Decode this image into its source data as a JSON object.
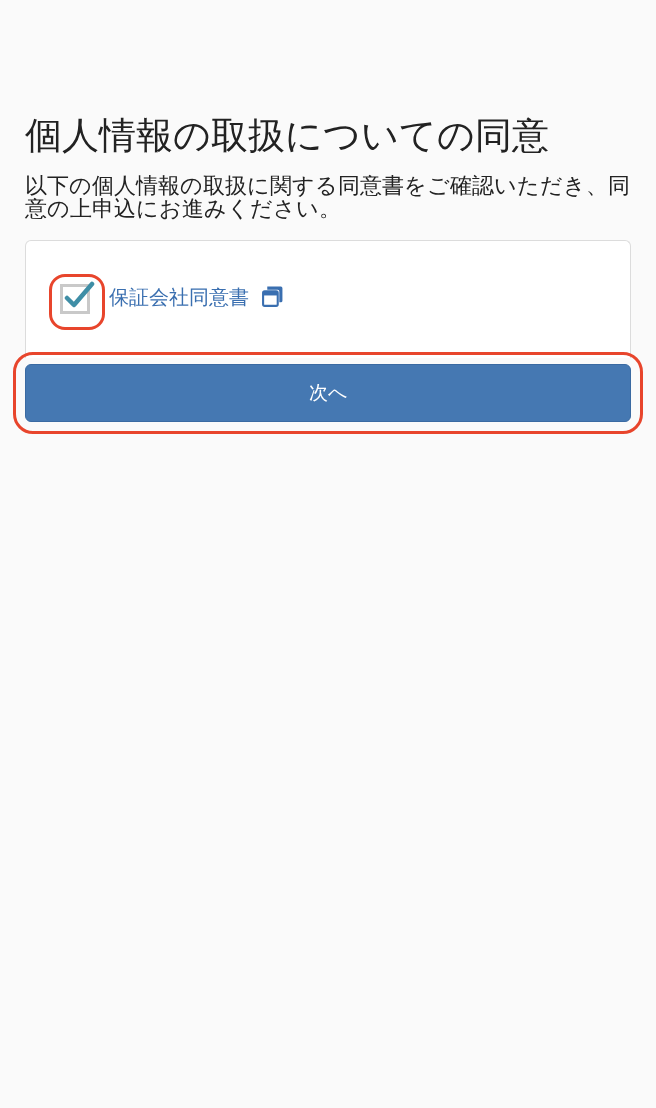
{
  "title": "個人情報の取扱についての同意",
  "description": "以下の個人情報の取扱に関する同意書をご確認いただき、同意の上申込にお進みください。",
  "consent_items": [
    {
      "label": "保証会社同意書",
      "checked": true,
      "highlighted": true
    }
  ],
  "next_button": {
    "label": "次へ",
    "highlighted": true
  }
}
